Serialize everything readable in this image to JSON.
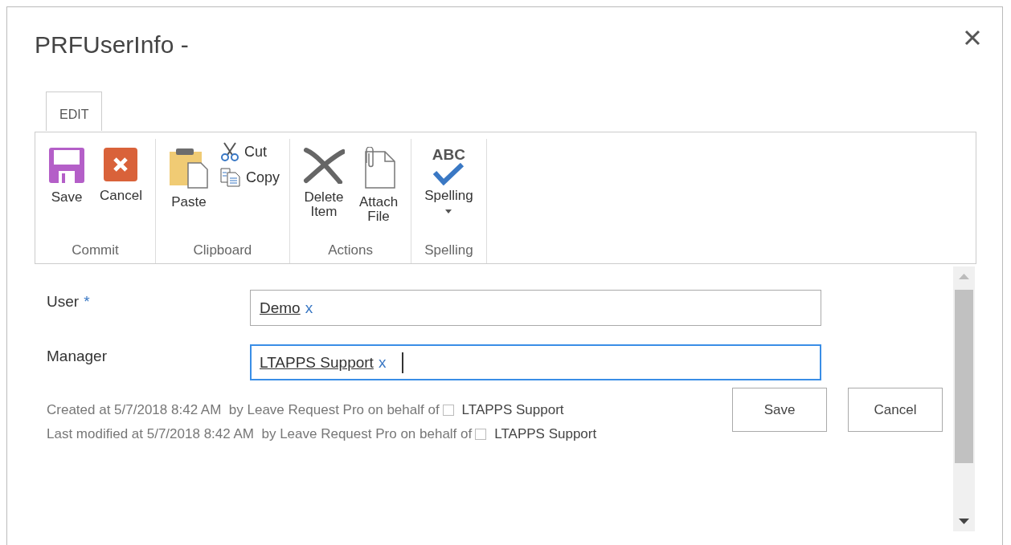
{
  "dialog": {
    "title": "PRFUserInfo -"
  },
  "tabs": [
    {
      "label": "EDIT",
      "selected": true
    }
  ],
  "ribbon_groups": [
    {
      "label": "Commit",
      "items": [
        {
          "kind": "large",
          "label": "Save"
        },
        {
          "kind": "large",
          "label": "Cancel"
        }
      ]
    },
    {
      "label": "Clipboard",
      "items": [
        {
          "kind": "large",
          "label": "Paste"
        },
        {
          "kind": "small",
          "label": "Cut"
        },
        {
          "kind": "small",
          "label": "Copy"
        }
      ]
    },
    {
      "label": "Actions",
      "items": [
        {
          "kind": "large",
          "label": "Delete Item"
        },
        {
          "kind": "large",
          "label": "Attach File"
        }
      ]
    },
    {
      "label": "Spelling",
      "items": [
        {
          "kind": "dropdown",
          "icon_text": "ABC",
          "label": "Spelling"
        }
      ]
    }
  ],
  "fields": [
    {
      "label": "User",
      "required_mark": "*",
      "value": "Demo",
      "remove": "x",
      "focused": false
    },
    {
      "label": "Manager",
      "value": "LTAPPS Support",
      "remove": "x",
      "focused": true
    }
  ],
  "audit": [
    {
      "text": "Created at 5/7/2018 8:42 AM  by Leave Request Pro on behalf of",
      "user": "LTAPPS Support"
    },
    {
      "text": "Last modified at 5/7/2018 8:42 AM  by Leave Request Pro on behalf of",
      "user": "LTAPPS Support"
    }
  ],
  "buttons": [
    "Save",
    "Cancel"
  ]
}
